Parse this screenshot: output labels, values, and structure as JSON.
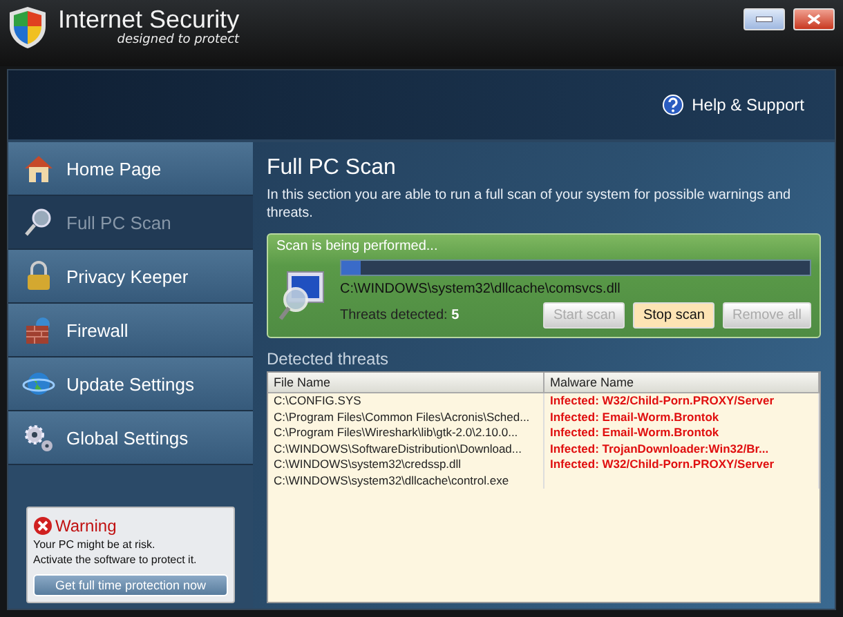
{
  "window": {
    "title": "Internet Security",
    "tagline": "designed to protect"
  },
  "header": {
    "help_link": "Help & Support"
  },
  "sidebar": {
    "items": [
      {
        "label": "Home Page",
        "selected": false
      },
      {
        "label": "Full PC Scan",
        "selected": true
      },
      {
        "label": "Privacy Keeper",
        "selected": false
      },
      {
        "label": "Firewall",
        "selected": false
      },
      {
        "label": "Update Settings",
        "selected": false
      },
      {
        "label": "Global Settings",
        "selected": false
      }
    ],
    "warning": {
      "title": "Warning",
      "message": "Your PC might be at risk.\nActivate the software to protect it.",
      "button": "Get full time protection now"
    }
  },
  "scan": {
    "title": "Full PC Scan",
    "description": "In this section you are able to run a full scan of your system for possible warnings and threats.",
    "status": "Scan is being performed...",
    "level": 0.04,
    "current_file": "C:\\WINDOWS\\system32\\dllcache\\comsvcs.dll",
    "threats_label": "Threats detected:",
    "threats_count": "5",
    "buttons": [
      {
        "label": "Start scan",
        "disabled": true
      },
      {
        "label": "Stop scan",
        "disabled": false
      },
      {
        "label": "Remove all",
        "disabled": true
      }
    ]
  },
  "threats": {
    "title": "Detected threats",
    "columns": [
      "File Name",
      "Malware Name"
    ],
    "rows": [
      {
        "file": "C:\\CONFIG.SYS",
        "malware": "Infected: W32/Child-Porn.PROXY/Server"
      },
      {
        "file": "C:\\Program Files\\Common Files\\Acronis\\Sched...",
        "malware": "Infected: Email-Worm.Brontok"
      },
      {
        "file": "C:\\Program Files\\Wireshark\\lib\\gtk-2.0\\2.10.0...",
        "malware": "Infected: Email-Worm.Brontok"
      },
      {
        "file": "C:\\WINDOWS\\SoftwareDistribution\\Download...",
        "malware": "Infected: TrojanDownloader:Win32/Br..."
      },
      {
        "file": "C:\\WINDOWS\\system32\\credssp.dll",
        "malware": "Infected: W32/Child-Porn.PROXY/Server"
      },
      {
        "file": "C:\\WINDOWS\\system32\\dllcache\\control.exe"
      }
    ]
  }
}
